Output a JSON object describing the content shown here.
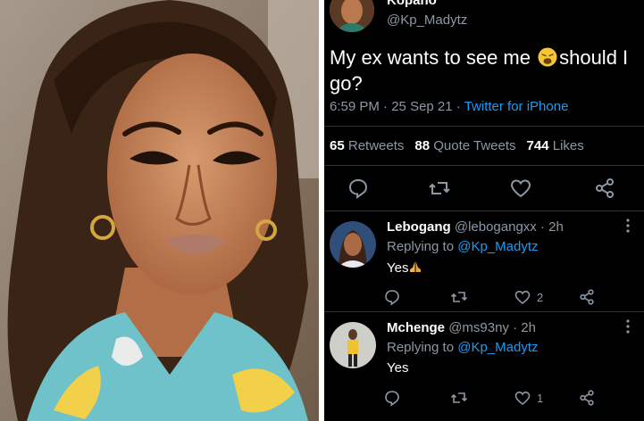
{
  "tweet": {
    "display_name": "Kopano",
    "handle": "@Kp_Madytz",
    "text_part1": "My ex wants to see me ",
    "emoji": "weary-face",
    "text_part2": "should I go?",
    "time": "6:59 PM",
    "separator": " · ",
    "date": "25 Sep 21",
    "source": "Twitter for iPhone",
    "retweets_count": "65",
    "retweets_label": "Retweets",
    "quotes_count": "88",
    "quotes_label": "Quote Tweets",
    "likes_count": "744",
    "likes_label": "Likes"
  },
  "replies": [
    {
      "name": "Lebogang",
      "handle": "@lebogangxx",
      "time": "· 2h",
      "replying_label": "Replying to ",
      "replying_to": "@Kp_Madytz",
      "text": "Yes",
      "emoji": "folded-hands",
      "likes": "2"
    },
    {
      "name": "Mchenge",
      "handle": "@ms93ny",
      "time": "· 2h",
      "replying_label": "Replying to ",
      "replying_to": "@Kp_Madytz",
      "text": "Yes",
      "likes": "1"
    }
  ],
  "colors": {
    "background": "#000000",
    "text": "#ffffff",
    "muted": "#8b98a5",
    "link": "#1d9bf0",
    "divider": "#2f3336"
  }
}
